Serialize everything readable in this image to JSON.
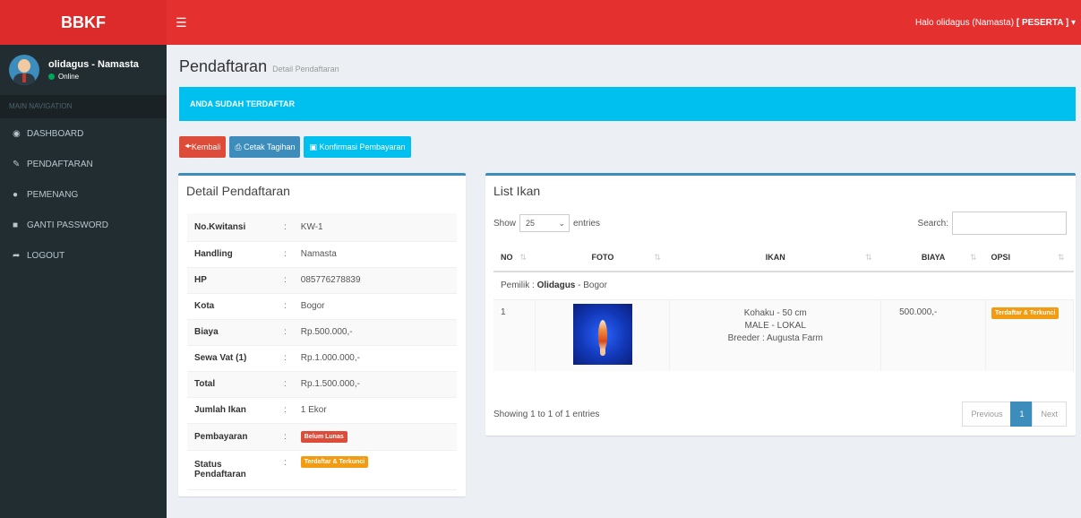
{
  "header": {
    "logo": "BBKF",
    "user_greeting": "Halo olidagus (Namasta)",
    "user_role": "[ PESERTA ]"
  },
  "sidebar": {
    "user_name": "olidagus - Namasta",
    "user_status": "Online",
    "nav_header": "MAIN NAVIGATION",
    "items": [
      {
        "label": "DASHBOARD",
        "icon": "dashboard-icon"
      },
      {
        "label": "PENDAFTARAN",
        "icon": "edit-icon"
      },
      {
        "label": "PEMENANG",
        "icon": "circle-icon"
      },
      {
        "label": "GANTI PASSWORD",
        "icon": "lock-icon"
      },
      {
        "label": "LOGOUT",
        "icon": "share-icon"
      }
    ]
  },
  "page": {
    "title": "Pendaftaran",
    "subtitle": "Detail Pendaftaran",
    "callout": "ANDA SUDAH TERDAFTAR"
  },
  "buttons": {
    "back": "Kembali",
    "print": "Cetak Tagihan",
    "confirm": "Konfirmasi Pembayaran"
  },
  "detail": {
    "title": "Detail Pendaftaran",
    "rows": [
      {
        "key": "No.Kwitansi",
        "value": "KW-1"
      },
      {
        "key": "Handling",
        "value": "Namasta"
      },
      {
        "key": "HP",
        "value": "085776278839"
      },
      {
        "key": "Kota",
        "value": "Bogor"
      },
      {
        "key": "Biaya",
        "value": "Rp.500.000,-"
      },
      {
        "key": "Sewa Vat (1)",
        "value": "Rp.1.000.000,-"
      },
      {
        "key": "Total",
        "value": "Rp.1.500.000,-"
      },
      {
        "key": "Jumlah Ikan",
        "value": "1 Ekor"
      },
      {
        "key": "Pembayaran",
        "value": "Belum Lunas"
      },
      {
        "key": "Status Pendaftaran",
        "value": "Terdaftar & Terkunci"
      }
    ],
    "colon": ":"
  },
  "list": {
    "title": "List Ikan",
    "show_label": "Show",
    "entries_value": "25",
    "entries_label": "entries",
    "search_label": "Search:",
    "columns": [
      "NO",
      "FOTO",
      "IKAN",
      "BIAYA",
      "OPSI"
    ],
    "owner_label": "Pemilik :",
    "owner_name": "Olidagus",
    "owner_city": "- Bogor",
    "row": {
      "no": "1",
      "ikan_line1": "Kohaku - 50 cm",
      "ikan_line2": "MALE - LOKAL",
      "ikan_line3": "Breeder : Augusta Farm",
      "biaya": "500.000,-",
      "opsi": "Terdaftar & Terkunci"
    },
    "showing": "Showing 1 to 1 of 1 entries",
    "pager": {
      "prev": "Previous",
      "page": "1",
      "next": "Next"
    }
  }
}
